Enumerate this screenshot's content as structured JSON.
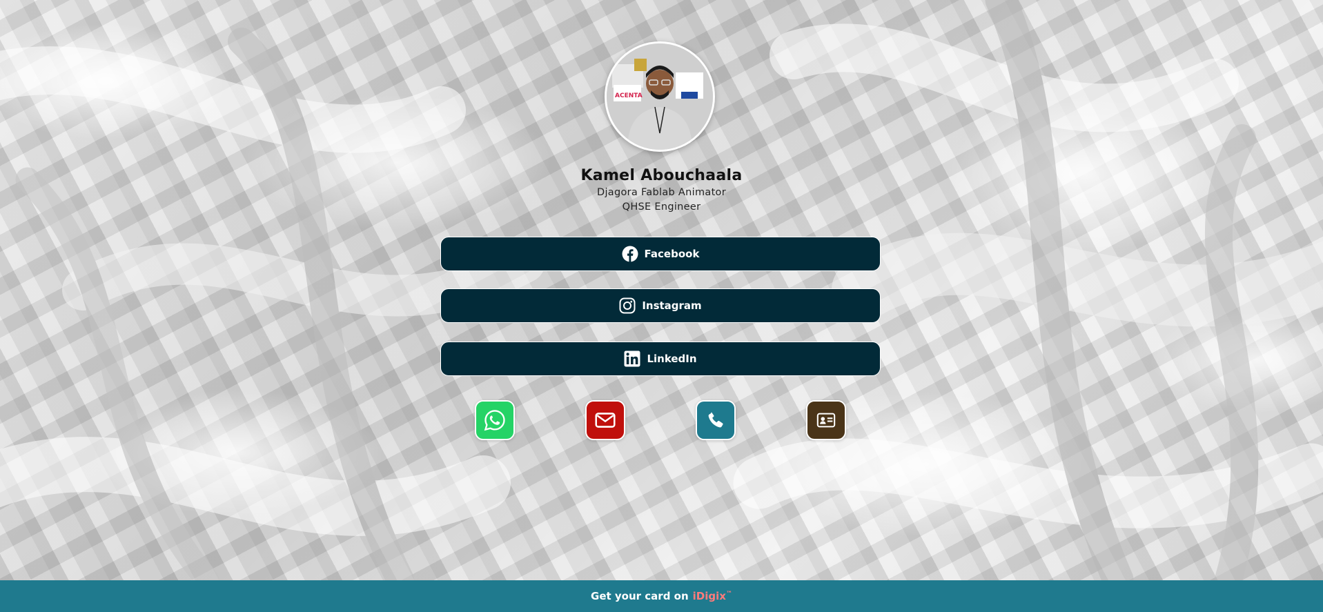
{
  "profile": {
    "name": "Kamel Abouchaala",
    "subtitle_line1": "Djagora Fablab Animator",
    "subtitle_line2": "QHSE Engineer"
  },
  "links": [
    {
      "label": "Facebook",
      "icon": "facebook-icon"
    },
    {
      "label": "Instagram",
      "icon": "instagram-icon"
    },
    {
      "label": "LinkedIn",
      "icon": "linkedin-icon"
    }
  ],
  "quick_actions": [
    {
      "icon": "whatsapp-icon",
      "color": "#25d366"
    },
    {
      "icon": "email-icon",
      "color": "#c0100c"
    },
    {
      "icon": "phone-icon",
      "color": "#1e7a8e"
    },
    {
      "icon": "contact-card-icon",
      "color": "#4a3418"
    }
  ],
  "footer": {
    "prefix": "Get your card on",
    "brand": "iDigix",
    "trademark": "™"
  },
  "colors": {
    "button_bg": "#022a38",
    "footer_bg": "#1f7a8e",
    "brand_accent": "#ff7b7b"
  }
}
